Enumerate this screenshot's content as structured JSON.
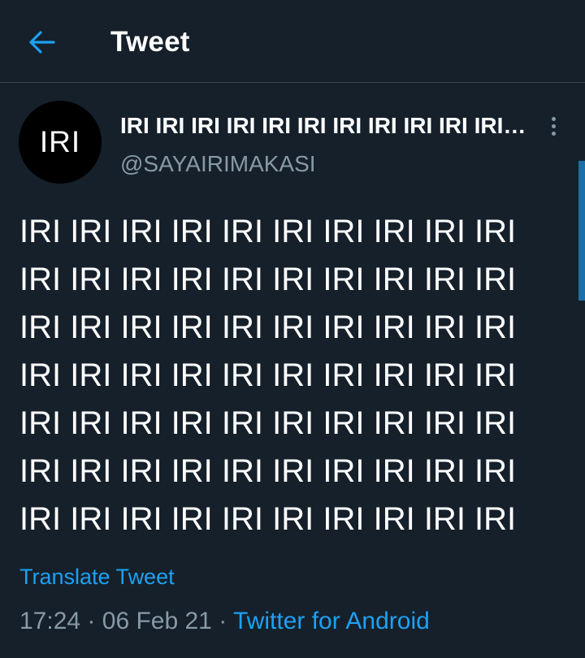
{
  "header": {
    "title": "Tweet",
    "back_icon": "arrow-left-icon"
  },
  "colors": {
    "background": "#15202b",
    "accent": "#1da1f2",
    "secondary_text": "#8899a6",
    "divider": "#38444d"
  },
  "author": {
    "avatar_text": "IRI",
    "display_name": "IRI IRI IRI IRI IRI IRI IRI IRI IRI IRI IRI IRI IRI",
    "handle": "@SAYAIRIMAKASI",
    "more_icon": "more-vertical-icon"
  },
  "tweet": {
    "text": "IRI IRI IRI IRI IRI IRI IRI IRI IRI IRI\nIRI IRI IRI IRI IRI IRI IRI IRI IRI IRI\nIRI IRI IRI IRI IRI IRI IRI IRI IRI IRI\nIRI IRI IRI IRI IRI IRI IRI IRI IRI IRI\nIRI IRI IRI IRI IRI IRI IRI IRI IRI IRI\nIRI IRI IRI IRI IRI IRI IRI IRI IRI IRI\nIRI IRI IRI IRI IRI IRI IRI IRI IRI IRI",
    "translate_label": "Translate Tweet",
    "time": "17:24",
    "separator": "·",
    "date": "06 Feb 21",
    "source": "Twitter for Android"
  }
}
